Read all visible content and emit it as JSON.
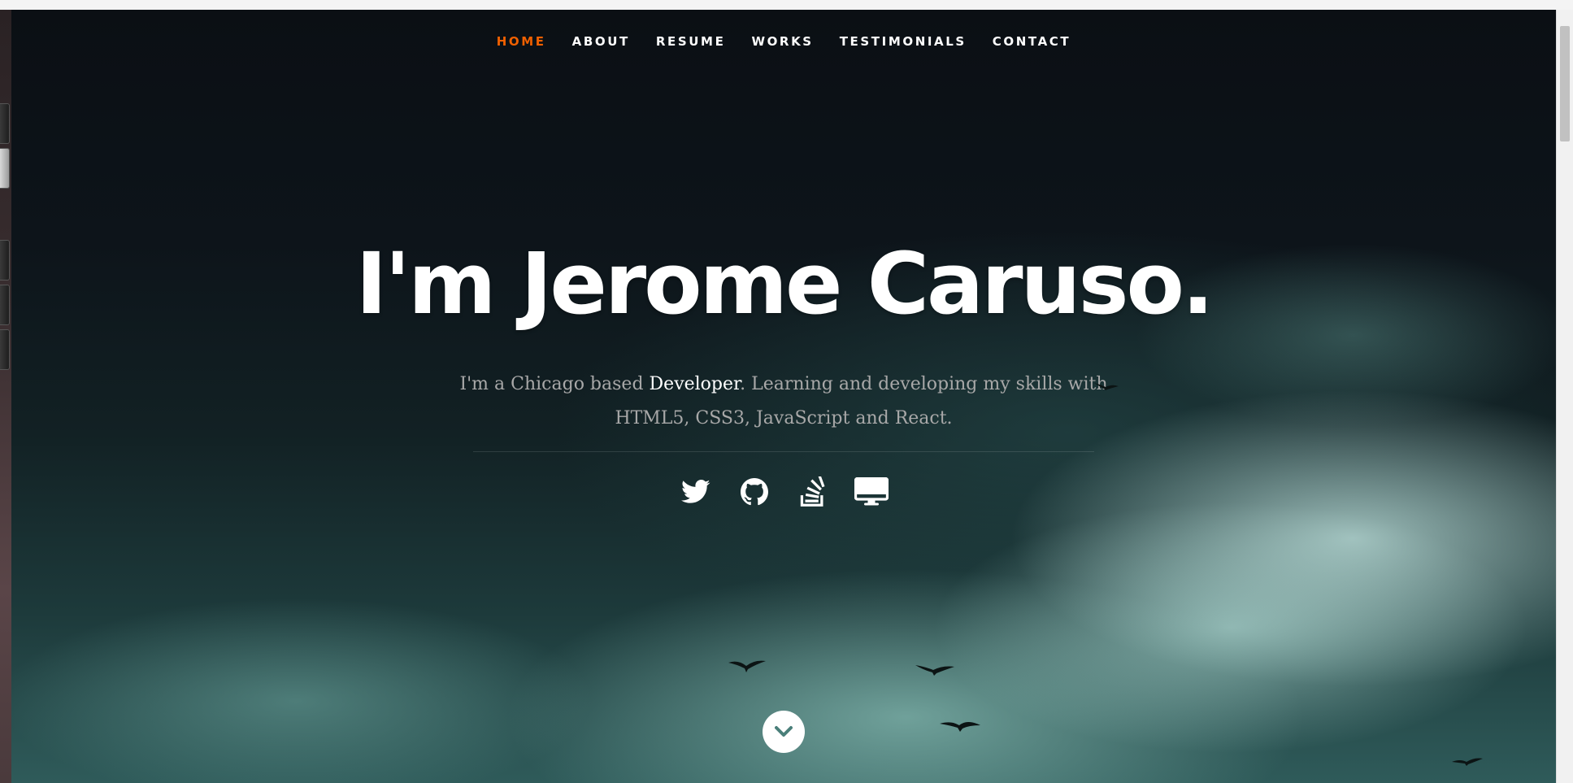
{
  "nav": {
    "items": [
      {
        "label": "HOME",
        "active": true
      },
      {
        "label": "ABOUT",
        "active": false
      },
      {
        "label": "RESUME",
        "active": false
      },
      {
        "label": "WORKS",
        "active": false
      },
      {
        "label": "TESTIMONIALS",
        "active": false
      },
      {
        "label": "CONTACT",
        "active": false
      }
    ]
  },
  "hero": {
    "headline": "I'm Jerome Caruso.",
    "intro_prefix": "I'm a Chicago based ",
    "intro_highlight": "Developer",
    "intro_suffix": ". Learning and developing my skills with HTML5, CSS3, JavaScript and React."
  },
  "socials": [
    {
      "icon": "twitter-icon"
    },
    {
      "icon": "github-icon"
    },
    {
      "icon": "stackoverflow-icon"
    },
    {
      "icon": "desktop-icon"
    }
  ],
  "scroll_down": {
    "icon": "chevron-down-icon"
  },
  "colors": {
    "accent": "#F06000",
    "text": "#FFFFFF",
    "intro_text": "#A8A8A8"
  }
}
